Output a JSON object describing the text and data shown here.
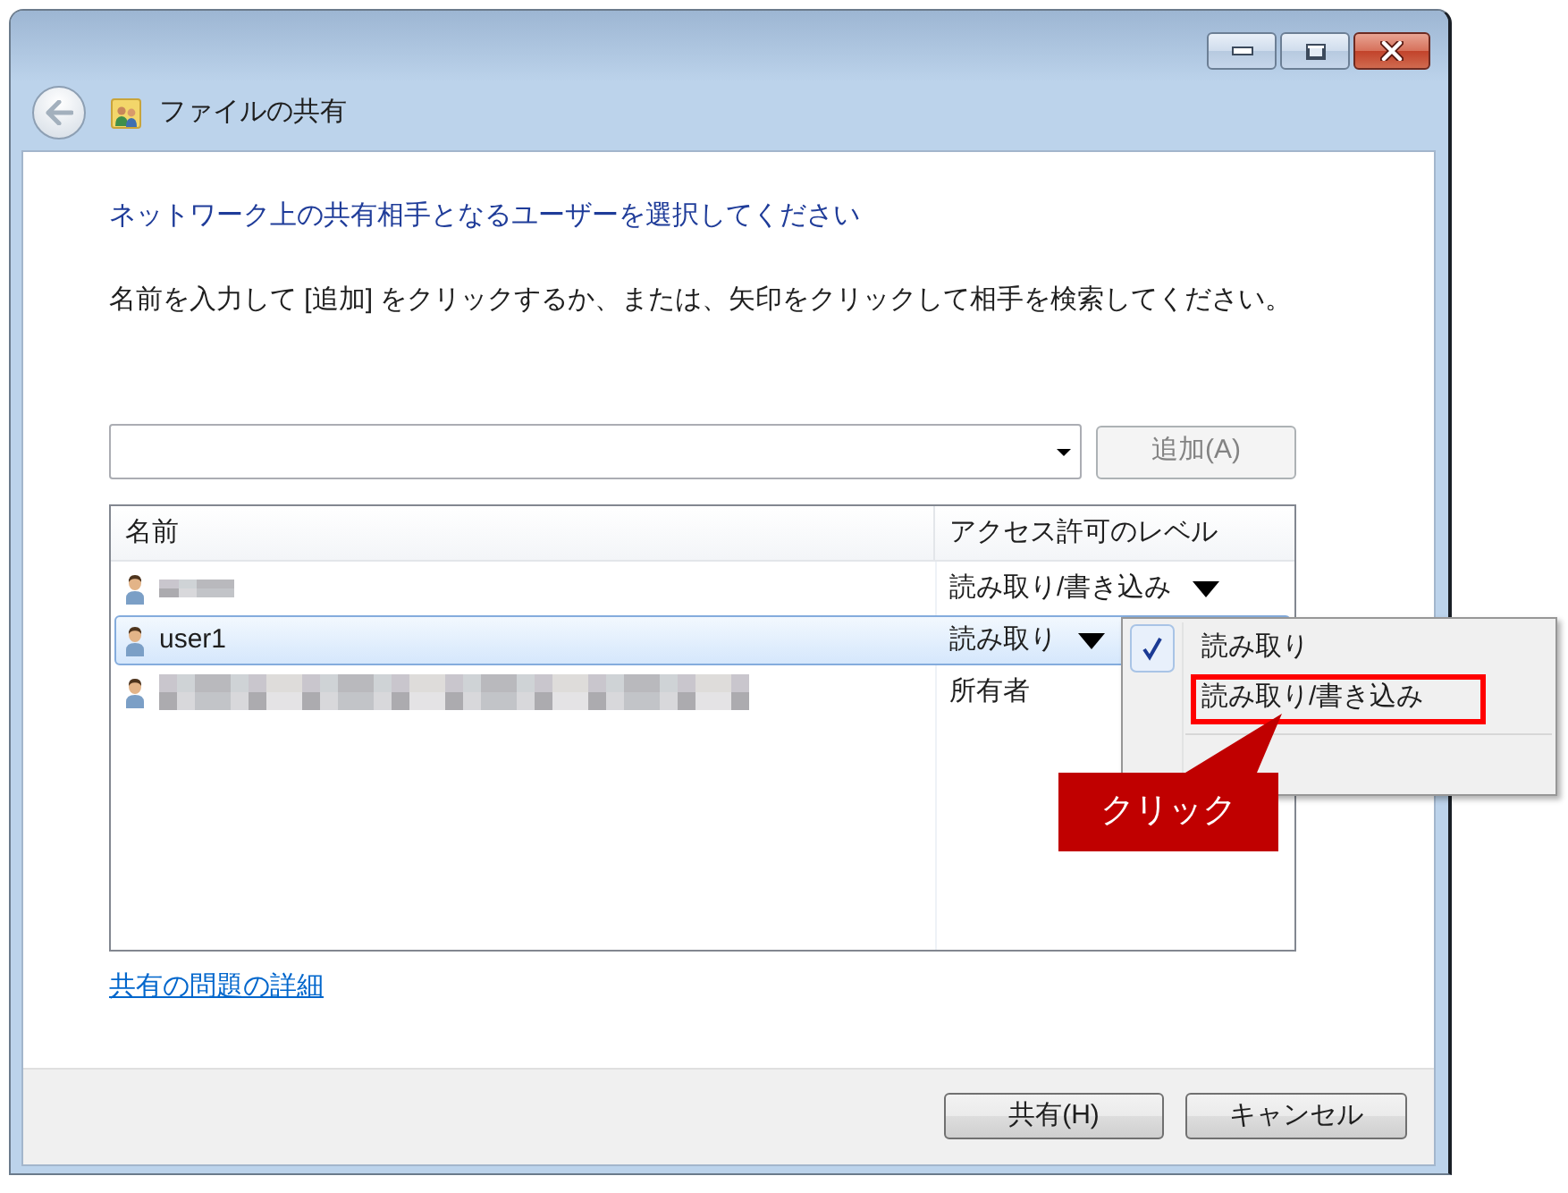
{
  "window": {
    "title": "ファイルの共有"
  },
  "heading": "ネットワーク上の共有相手となるユーザーを選択してください",
  "instructions": "名前を入力して [追加] をクリックするか、または、矢印をクリックして相手を検索してください。",
  "add_button": {
    "label": "追加(A)",
    "disabled": true
  },
  "table": {
    "columns": [
      "名前",
      "アクセス許可のレベル"
    ],
    "rows": [
      {
        "kind": "masked",
        "access": "読み取り/書き込み",
        "dropdown": true,
        "selected": false
      },
      {
        "kind": "user",
        "name": "user1",
        "access": "読み取り",
        "dropdown": true,
        "selected": true
      },
      {
        "kind": "masked",
        "access": "所有者",
        "dropdown": false,
        "selected": false
      }
    ]
  },
  "access_menu": {
    "items": [
      {
        "label": "読み取り",
        "checked": true,
        "highlighted": false
      },
      {
        "label": "読み取り/書き込み",
        "checked": false,
        "highlighted": true
      }
    ]
  },
  "callout": {
    "text": "クリック"
  },
  "link": "共有の問題の詳細",
  "buttons": [
    "共有(H)",
    "キャンセル"
  ]
}
